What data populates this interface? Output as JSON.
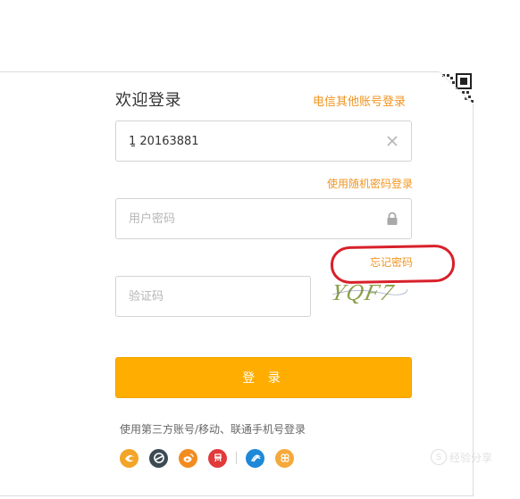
{
  "login": {
    "title": "欢迎登录",
    "other_account_link": "电信其他账号登录",
    "phone_value": "1̱̱̱ 20163881",
    "random_password_link": "使用随机密码登录",
    "password_placeholder": "用户密码",
    "forgot_password_link": "忘记密码",
    "captcha_placeholder": "验证码",
    "captcha_text": "YQF7",
    "login_button": "登 录",
    "third_party_label": "使用第三方账号/移动、联通手机号登录"
  },
  "social_icons": [
    "yiwan-icon",
    "qq-icon",
    "weibo-icon",
    "yixin-icon",
    "china-mobile-icon",
    "china-unicom-icon"
  ],
  "watermark": {
    "text": "经验分享"
  },
  "colors": {
    "accent_orange": "#f19520",
    "button_orange": "#ffad00",
    "annotation_red": "#d8202a"
  }
}
